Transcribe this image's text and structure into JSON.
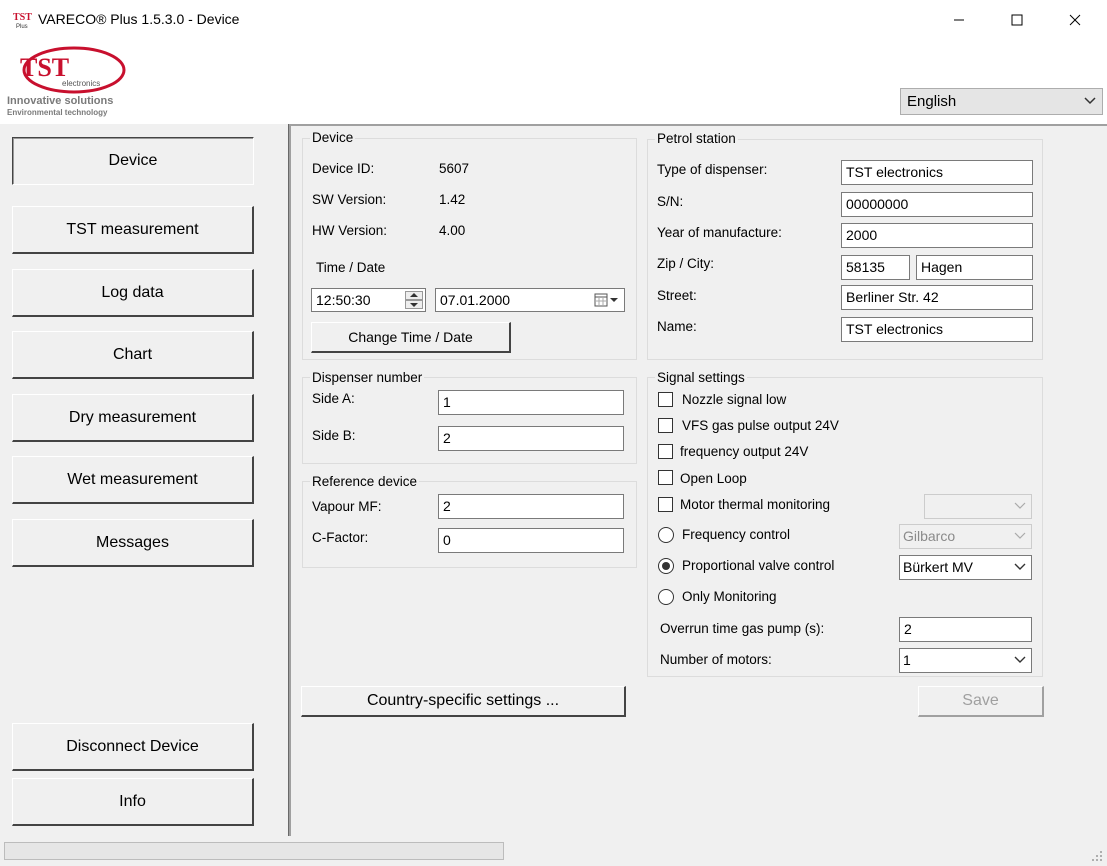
{
  "window": {
    "title": "VARECO® Plus 1.5.3.0 - Device"
  },
  "logo": {
    "brand": "TST",
    "sub": "electronics",
    "line1": "Innovative solutions",
    "line2": "Environmental technology"
  },
  "language": {
    "selected": "English"
  },
  "nav": {
    "device": "Device",
    "tst_measurement": "TST measurement",
    "log_data": "Log data",
    "chart": "Chart",
    "dry_measurement": "Dry measurement",
    "wet_measurement": "Wet measurement",
    "messages": "Messages",
    "disconnect": "Disconnect Device",
    "info": "Info"
  },
  "device": {
    "title": "Device",
    "id_label": "Device ID:",
    "id_value": "5607",
    "sw_label": "SW Version:",
    "sw_value": "1.42",
    "hw_label": "HW Version:",
    "hw_value": "4.00",
    "time_date_label": "Time / Date",
    "time": "12:50:30",
    "date": "07.01.2000",
    "change_button": "Change Time / Date"
  },
  "dispenser": {
    "title": "Dispenser number",
    "side_a_label": "Side A:",
    "side_a": "1",
    "side_b_label": "Side B:",
    "side_b": "2"
  },
  "reference": {
    "title": "Reference device",
    "vapour_label": "Vapour MF:",
    "vapour": "2",
    "cfactor_label": "C-Factor:",
    "cfactor": "0"
  },
  "petrol": {
    "title": "Petrol station",
    "type_label": "Type of dispenser:",
    "type": "TST electronics",
    "sn_label": "S/N:",
    "sn": "00000000",
    "year_label": "Year of manufacture:",
    "year": "2000",
    "zip_label": "Zip / City:",
    "zip": "58135",
    "city": "Hagen",
    "street_label": "Street:",
    "street": "Berliner Str. 42",
    "name_label": "Name:",
    "name": "TST electronics"
  },
  "signal": {
    "title": "Signal settings",
    "nozzle": "Nozzle signal low",
    "vfs": "VFS gas pulse output 24V",
    "freq_out": "frequency output 24V",
    "open_loop": "Open Loop",
    "motor_thermal": "Motor thermal monitoring",
    "freq_control": "Frequency control",
    "freq_control_value": "Gilbarco",
    "prop_valve": "Proportional valve control",
    "prop_valve_value": "Bürkert MV",
    "only_monitoring": "Only Monitoring",
    "overrun_label": "Overrun time gas pump (s):",
    "overrun": "2",
    "motors_label": "Number of motors:",
    "motors": "1"
  },
  "actions": {
    "country": "Country-specific settings ...",
    "save": "Save"
  },
  "colors": {
    "logo_red": "#c8102e",
    "accent_gray": "#7a7a7a"
  }
}
